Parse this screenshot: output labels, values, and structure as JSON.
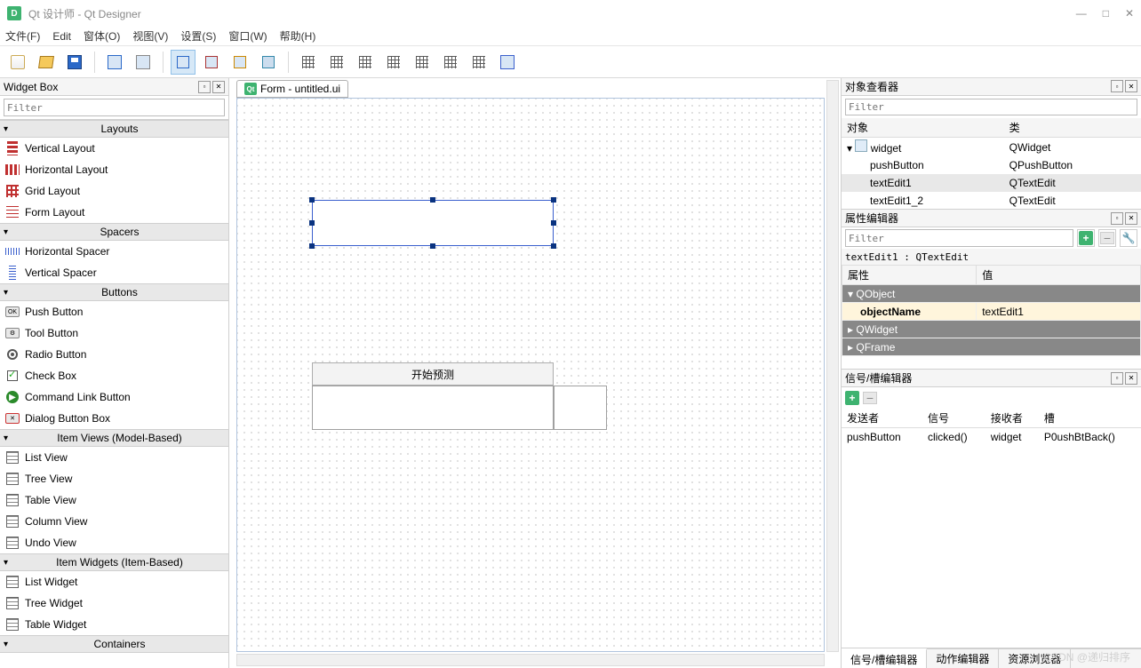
{
  "window": {
    "title": "Qt 设计师 - Qt Designer",
    "minimize": "—",
    "maximize": "□",
    "close": "✕"
  },
  "menu": {
    "file": "文件(F)",
    "edit": "Edit",
    "form": "窗体(O)",
    "view": "视图(V)",
    "settings": "设置(S)",
    "window": "窗口(W)",
    "help": "帮助(H)"
  },
  "widgetbox": {
    "title": "Widget Box",
    "filter_placeholder": "Filter",
    "cat_layouts": "Layouts",
    "layouts": [
      "Vertical Layout",
      "Horizontal Layout",
      "Grid Layout",
      "Form Layout"
    ],
    "cat_spacers": "Spacers",
    "spacers": [
      "Horizontal Spacer",
      "Vertical Spacer"
    ],
    "cat_buttons": "Buttons",
    "buttons": [
      "Push Button",
      "Tool Button",
      "Radio Button",
      "Check Box",
      "Command Link Button",
      "Dialog Button Box"
    ],
    "cat_itemviews": "Item Views (Model-Based)",
    "itemviews": [
      "List View",
      "Tree View",
      "Table View",
      "Column View",
      "Undo View"
    ],
    "cat_itemwidgets": "Item Widgets (Item-Based)",
    "itemwidgets": [
      "List Widget",
      "Tree Widget",
      "Table Widget"
    ],
    "cat_containers": "Containers"
  },
  "form": {
    "tab_title": "Form - untitled.ui",
    "pushbutton_text": "开始预测"
  },
  "object_inspector": {
    "title": "对象查看器",
    "filter_placeholder": "Filter",
    "col_object": "对象",
    "col_class": "类",
    "rows": [
      {
        "name": "widget",
        "cls": "QWidget",
        "indent": 0,
        "exp": "v"
      },
      {
        "name": "pushButton",
        "cls": "QPushButton",
        "indent": 1
      },
      {
        "name": "textEdit1",
        "cls": "QTextEdit",
        "indent": 1,
        "sel": true
      },
      {
        "name": "textEdit1_2",
        "cls": "QTextEdit",
        "indent": 1
      }
    ]
  },
  "property_editor": {
    "title": "属性编辑器",
    "filter_placeholder": "Filter",
    "object_label": "textEdit1 : QTextEdit",
    "col_prop": "属性",
    "col_val": "值",
    "cat_qobject": "QObject",
    "prop_objectName": "objectName",
    "val_objectName": "textEdit1",
    "cat_qwidget": "QWidget",
    "cat_qframe": "QFrame"
  },
  "signal_editor": {
    "title": "信号/槽编辑器",
    "col_sender": "发送者",
    "col_signal": "信号",
    "col_receiver": "接收者",
    "col_slot": "槽",
    "rows": [
      {
        "sender": "pushButton",
        "signal": "clicked()",
        "receiver": "widget",
        "slot": "P0ushBtBack()"
      }
    ]
  },
  "bottom_tabs": {
    "signal": "信号/槽编辑器",
    "action": "动作编辑器",
    "resource": "资源浏览器"
  },
  "watermark": "CSDN @递归排序"
}
